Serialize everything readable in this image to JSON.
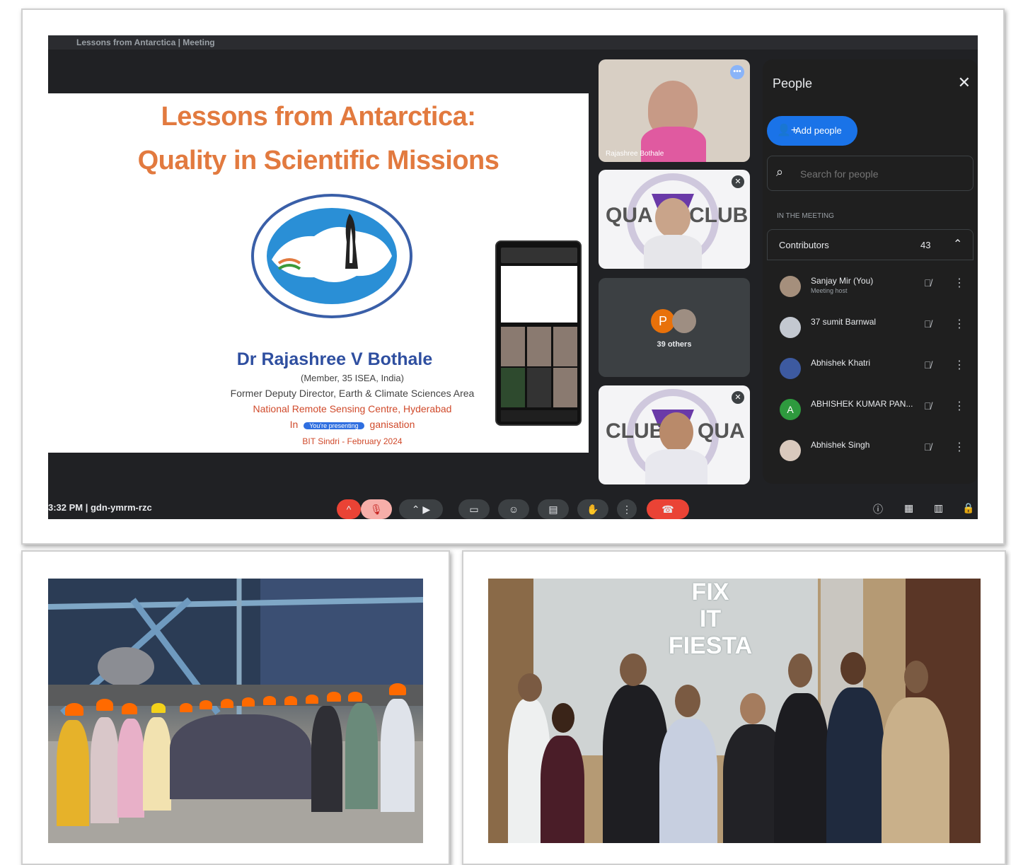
{
  "meeting": {
    "topbar_title": "Lessons from Antarctica | Meeting",
    "slide": {
      "title_line1": "Lessons from Antarctica:",
      "title_line2": "Quality in Scientific Missions",
      "presenter": "Dr Rajashree V Bothale",
      "line1": "(Member, 35 ISEA, India)",
      "line2": "Former Deputy Director, Earth & Climate Sciences Area",
      "line3": "National Remote Sensing Centre, Hyderabad",
      "line4_prefix": "In",
      "line4_pill": "You're presenting",
      "line4_suffix": "ganisation",
      "line5": "BIT Sindri - February 2024"
    },
    "tiles": [
      {
        "label": "Rajashree Bothale"
      },
      {
        "club_left": "QUA",
        "club_right": "CLUB"
      },
      {
        "avatar_letter": "P",
        "others": "39 others"
      },
      {
        "club_left": "CLUB",
        "club_right": "QUA"
      }
    ],
    "people_panel": {
      "title": "People",
      "close": "✕",
      "add_people": "Add people",
      "search_placeholder": "Search for people",
      "in_meeting": "IN THE MEETING",
      "contributors_label": "Contributors",
      "contributors_count": "43",
      "people": [
        {
          "name": "Sanjay Mir (You)",
          "sub": "Meeting host",
          "avatar": ""
        },
        {
          "name": "37 sumit Barnwal",
          "sub": "",
          "avatar": ""
        },
        {
          "name": "Abhishek Khatri",
          "sub": "",
          "avatar": ""
        },
        {
          "name": "ABHISHEK KUMAR PAN...",
          "sub": "",
          "avatar": "A"
        },
        {
          "name": "Abhishek Singh",
          "sub": "",
          "avatar": ""
        }
      ]
    },
    "bottombar": {
      "clock": "3:32 PM  |  gdn-ymrm-rzc"
    }
  },
  "photos": {
    "fiesta_line1": "FIX",
    "fiesta_line2": "IT",
    "fiesta_line3": "FIESTA"
  },
  "colors": {
    "slide_title": "#e27a3f",
    "presenter": "#2f4fa0",
    "meet_bg": "#202124",
    "accent_blue": "#1a73e8",
    "end_call_red": "#ea4335"
  }
}
